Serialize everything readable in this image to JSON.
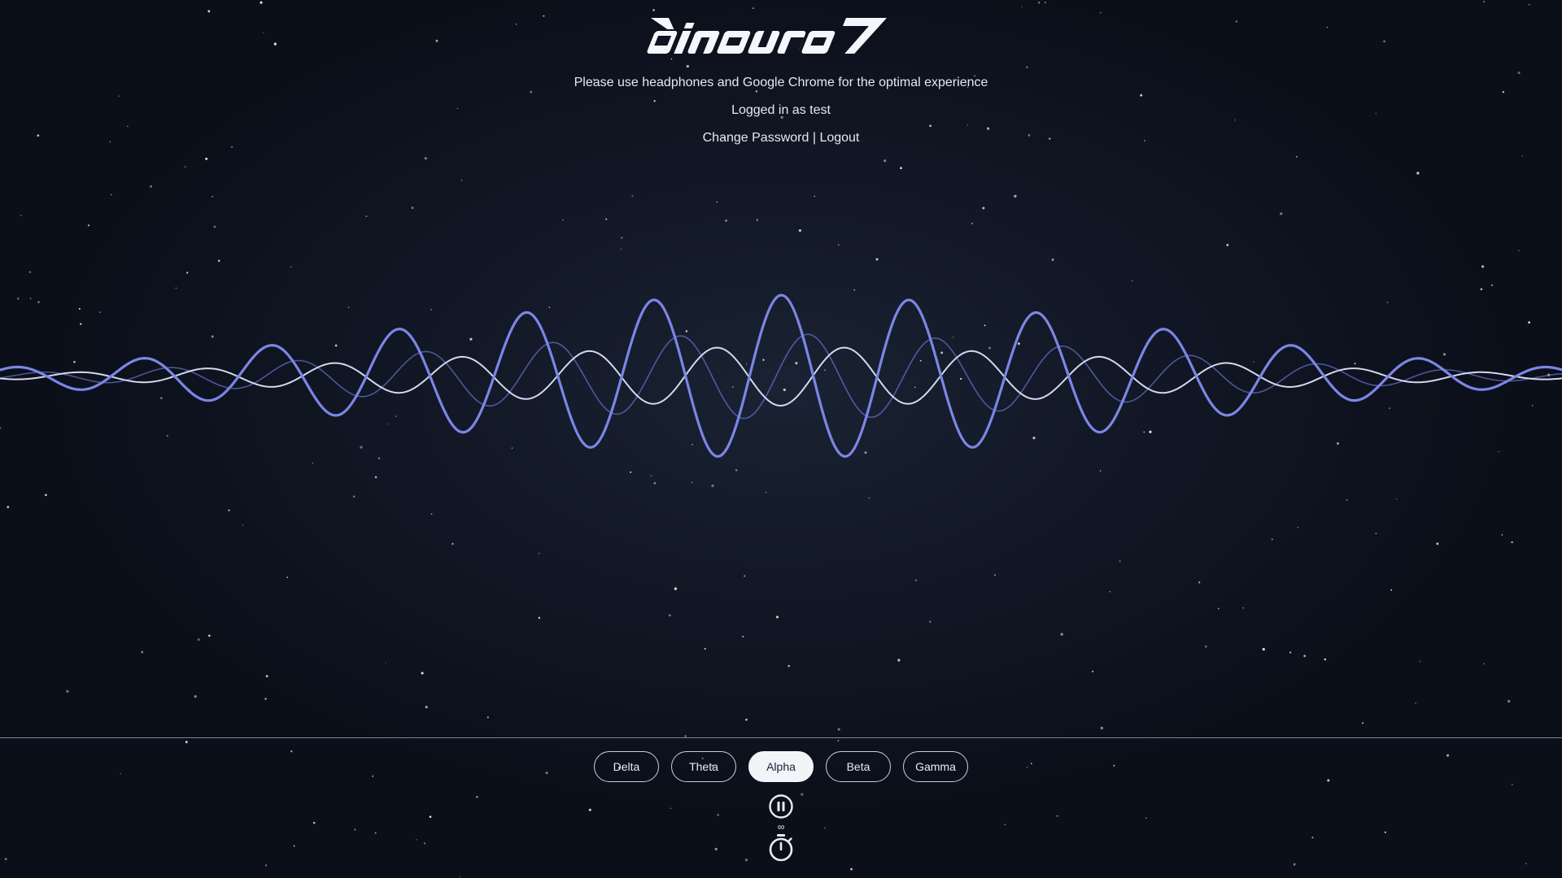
{
  "header": {
    "logo_text": "binaural",
    "notice": "Please use headphones and Google Chrome for the optimal experience",
    "login_status": "Logged in as test",
    "change_password_label": "Change Password",
    "separator": "|",
    "logout_label": "Logout"
  },
  "bands": [
    {
      "label": "Delta",
      "active": false
    },
    {
      "label": "Theta",
      "active": false
    },
    {
      "label": "Alpha",
      "active": true
    },
    {
      "label": "Beta",
      "active": false
    },
    {
      "label": "Gamma",
      "active": false
    }
  ],
  "playback": {
    "state_icon": "pause-icon",
    "duration_text": "∞",
    "timer_icon": "stopwatch-icon"
  },
  "colors": {
    "background": "#0b0f1a",
    "wave_primary": "#7b86e6",
    "wave_secondary": "#d4d8ee",
    "text": "#e8ecf4",
    "active_band_bg": "#f2f4f8"
  }
}
